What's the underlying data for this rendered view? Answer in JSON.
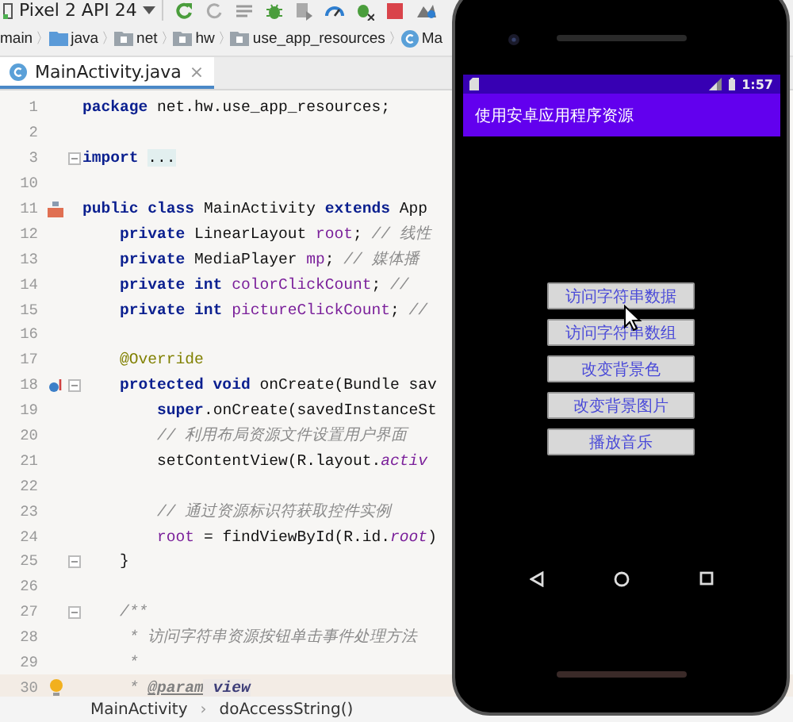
{
  "toolbar": {
    "device": "Pixel 2 API 24"
  },
  "breadcrumbs": [
    {
      "kind": "plain",
      "label": "main"
    },
    {
      "kind": "source",
      "label": "java",
      "separator": "〉"
    },
    {
      "kind": "package",
      "label": "net",
      "separator": "〉"
    },
    {
      "kind": "package",
      "label": "hw",
      "separator": "〉"
    },
    {
      "kind": "package",
      "label": "use_app_resources",
      "separator": "〉"
    },
    {
      "kind": "class",
      "label": "Ma",
      "separator": "〉"
    }
  ],
  "tabs": [
    {
      "label": "MainActivity.java",
      "selected": true,
      "close": "×"
    }
  ],
  "editor": {
    "lines": [
      {
        "number": "1",
        "segments": [
          {
            "kind": "kw",
            "text": "package"
          },
          {
            "kind": "plain",
            "text": " net.hw.use_app_resources;"
          }
        ]
      },
      {
        "number": "2"
      },
      {
        "number": "3",
        "fold": true,
        "segments": [
          {
            "kind": "kw",
            "text": "import "
          },
          {
            "kind": "folded",
            "text": "..."
          }
        ]
      },
      {
        "number": "10"
      },
      {
        "number": "11",
        "implements_marker": true,
        "segments": [
          {
            "kind": "kw",
            "text": "public class"
          },
          {
            "kind": "plain",
            "text": " MainActivity "
          },
          {
            "kind": "kw",
            "text": "extends"
          },
          {
            "kind": "plain",
            "text": " App"
          }
        ],
        "children": [
          {
            "number": "12",
            "segments": [
              {
                "kind": "kw",
                "text": "private"
              },
              {
                "kind": "plain",
                "text": " LinearLayout "
              },
              {
                "kind": "field",
                "text": "root"
              },
              {
                "kind": "plain",
                "text": "; "
              },
              {
                "kind": "comment",
                "text": "// 线性"
              }
            ]
          },
          {
            "number": "13",
            "segments": [
              {
                "kind": "kw",
                "text": "private"
              },
              {
                "kind": "plain",
                "text": " MediaPlayer "
              },
              {
                "kind": "field",
                "text": "mp"
              },
              {
                "kind": "plain",
                "text": "; "
              },
              {
                "kind": "comment",
                "text": "// 媒体播"
              }
            ]
          },
          {
            "number": "14",
            "segments": [
              {
                "kind": "kw",
                "text": "private int "
              },
              {
                "kind": "field",
                "text": "colorClickCount"
              },
              {
                "kind": "plain",
                "text": "; "
              },
              {
                "kind": "comment",
                "text": "//"
              }
            ]
          },
          {
            "number": "15",
            "segments": [
              {
                "kind": "kw",
                "text": "private int "
              },
              {
                "kind": "field",
                "text": "pictureClickCount"
              },
              {
                "kind": "plain",
                "text": "; "
              },
              {
                "kind": "comment",
                "text": "//"
              }
            ]
          },
          {
            "number": "16"
          },
          {
            "number": "17",
            "segments": [
              {
                "kind": "annotation",
                "text": "@Override"
              }
            ]
          },
          {
            "number": "18",
            "override_marker": true,
            "fold": true,
            "segments": [
              {
                "kind": "kw",
                "text": "protected void"
              },
              {
                "kind": "plain",
                "text": " onCreate(Bundle sav"
              }
            ],
            "children": [
              {
                "number": "19",
                "segments": [
                  {
                    "kind": "kw",
                    "text": "super"
                  },
                  {
                    "kind": "plain",
                    "text": ".onCreate(savedInstanceSt"
                  }
                ]
              },
              {
                "number": "20",
                "segments": [
                  {
                    "kind": "comment",
                    "text": "// 利用布局资源文件设置用户界面"
                  }
                ]
              },
              {
                "number": "21",
                "segments": [
                  {
                    "kind": "plain",
                    "text": "setContentView(R.layout."
                  },
                  {
                    "kind": "static",
                    "text": "activ"
                  }
                ]
              },
              {
                "number": "22"
              },
              {
                "number": "23",
                "segments": [
                  {
                    "kind": "comment",
                    "text": "// 通过资源标识符获取控件实例"
                  }
                ]
              },
              {
                "number": "24",
                "segments": [
                  {
                    "kind": "field",
                    "text": "root"
                  },
                  {
                    "kind": "plain",
                    "text": " = findViewById(R.id."
                  },
                  {
                    "kind": "static",
                    "text": "root"
                  },
                  {
                    "kind": "plain",
                    "text": ")"
                  }
                ]
              }
            ]
          },
          {
            "number": "25",
            "fold": true,
            "segments": [
              {
                "kind": "plain",
                "text": "}"
              }
            ]
          },
          {
            "number": "26"
          },
          {
            "number": "27",
            "fold": true,
            "segments": [
              {
                "kind": "comment",
                "text": "/**"
              }
            ]
          },
          {
            "number": "28",
            "segments": [
              {
                "kind": "comment",
                "text": " * 访问字符串资源按钮单击事件处理方法"
              }
            ]
          },
          {
            "number": "29",
            "segments": [
              {
                "kind": "comment",
                "text": " *"
              }
            ]
          },
          {
            "number": "30",
            "current": true,
            "bulb": true,
            "segments": [
              {
                "kind": "comment",
                "text": " * "
              },
              {
                "kind": "doctag",
                "text": "@param"
              },
              {
                "kind": "docparam",
                "text": " view"
              }
            ]
          }
        ]
      }
    ]
  },
  "status_path": [
    {
      "label": "MainActivity"
    },
    {
      "label": "doAccessString()",
      "separator": "›"
    }
  ],
  "phone": {
    "time": "1:57",
    "app_title": "使用安卓应用程序资源",
    "buttons": [
      "访问字符串数据",
      "访问字符串数组",
      "改变背景色",
      "改变背景图片",
      "播放音乐"
    ]
  }
}
